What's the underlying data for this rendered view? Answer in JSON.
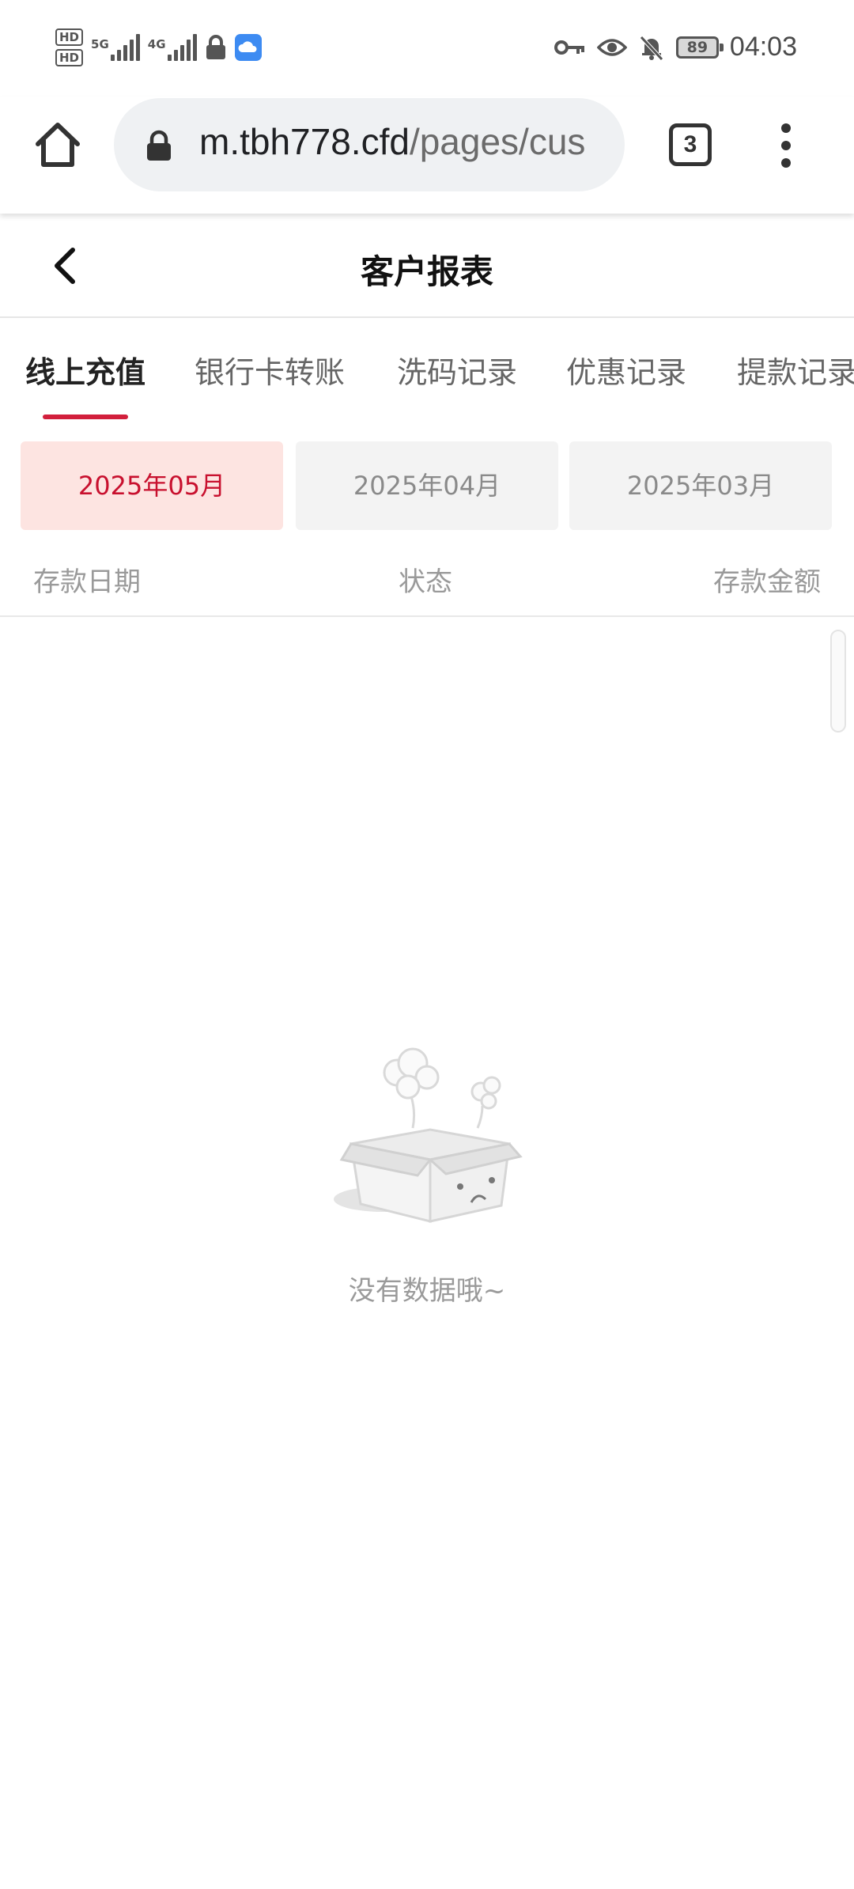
{
  "status_bar": {
    "hd1": "HD",
    "hd2": "HD",
    "net1": "5G",
    "net2": "4G",
    "battery": "89",
    "time": "04:03"
  },
  "browser": {
    "url_host": "m.tbh778.cfd",
    "url_path": "/pages/cus",
    "tab_count": "3"
  },
  "header": {
    "title": "客户报表"
  },
  "tabs": [
    {
      "label": "线上充值",
      "active": true
    },
    {
      "label": "银行卡转账"
    },
    {
      "label": "洗码记录"
    },
    {
      "label": "优惠记录"
    },
    {
      "label": "提款记录"
    }
  ],
  "months": [
    {
      "label": "2025年05月",
      "active": true
    },
    {
      "label": "2025年04月"
    },
    {
      "label": "2025年03月"
    }
  ],
  "table": {
    "columns": [
      "存款日期",
      "状态",
      "存款金额"
    ]
  },
  "empty_state": {
    "message": "没有数据哦~",
    "icon": "empty-box-illustration"
  },
  "colors": {
    "accent": "#d21f3c",
    "active_month_bg": "#fde4e1",
    "active_month_text": "#c8102e"
  }
}
